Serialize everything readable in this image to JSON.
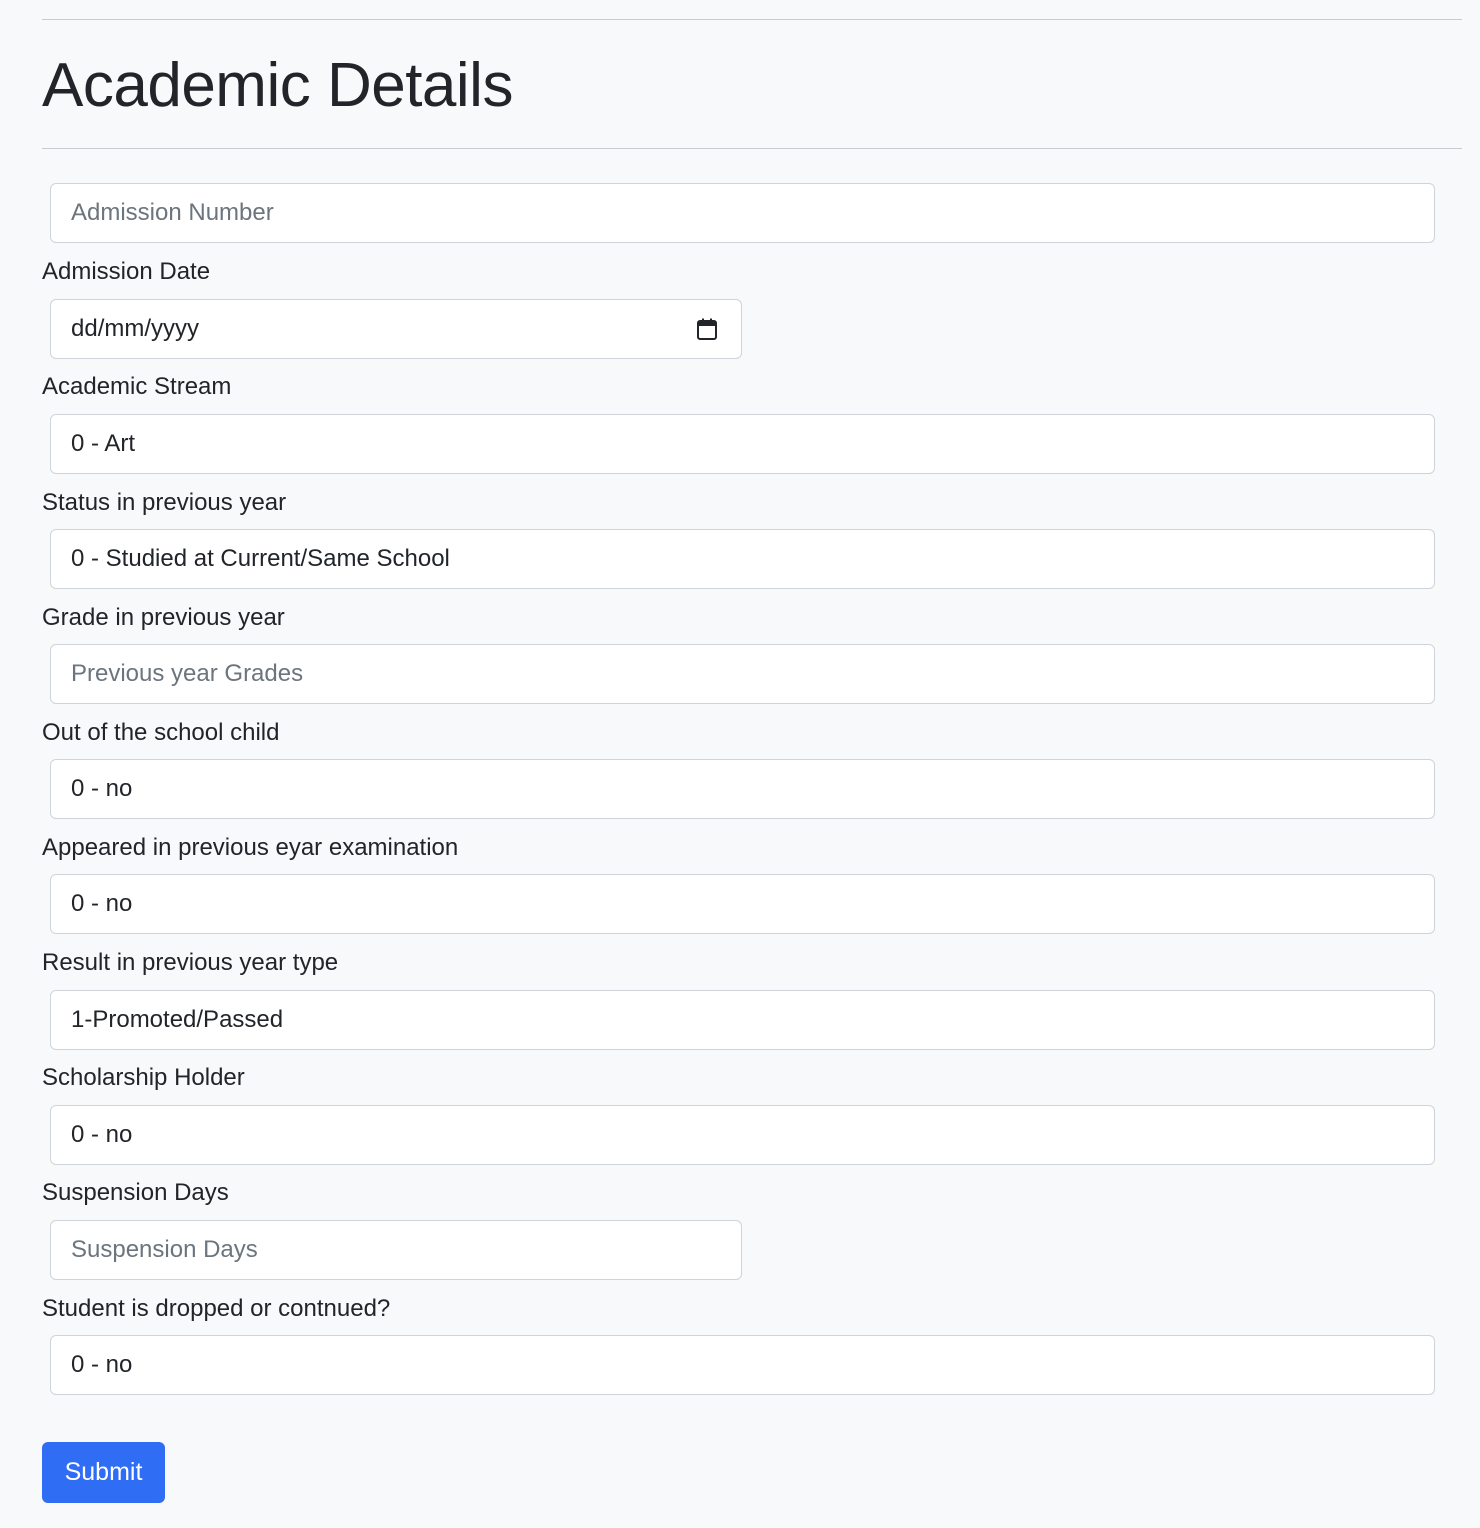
{
  "page": {
    "title": "Academic Details"
  },
  "form": {
    "admission_number": {
      "placeholder": "Admission Number",
      "value": ""
    },
    "admission_date": {
      "label": "Admission Date",
      "value": "dd/mm/yyyy",
      "icon": "calendar-icon"
    },
    "academic_stream": {
      "label": "Academic Stream",
      "selected": "0 - Art"
    },
    "status_previous_year": {
      "label": "Status in previous year",
      "selected": "0 - Studied at Current/Same School"
    },
    "grade_previous_year": {
      "label": "Grade in previous year",
      "placeholder": "Previous year Grades",
      "value": ""
    },
    "out_of_school_child": {
      "label": "Out of the school child",
      "selected": "0 - no"
    },
    "appeared_previous_exam": {
      "label": "Appeared in previous eyar examination",
      "selected": "0 - no"
    },
    "result_previous_year": {
      "label": "Result in previous year type",
      "selected": "1-Promoted/Passed"
    },
    "scholarship_holder": {
      "label": "Scholarship Holder",
      "selected": "0 - no"
    },
    "suspension_days": {
      "label": "Suspension Days",
      "placeholder": "Suspension Days",
      "value": ""
    },
    "dropped_or_continued": {
      "label": "Student is dropped or contnued?",
      "selected": "0 - no"
    },
    "submit_label": "Submit"
  },
  "colors": {
    "background": "#f8f9fa",
    "primary_button": "#2f6df5",
    "text": "#212529",
    "placeholder": "#6c757d",
    "border": "#ced4da"
  }
}
